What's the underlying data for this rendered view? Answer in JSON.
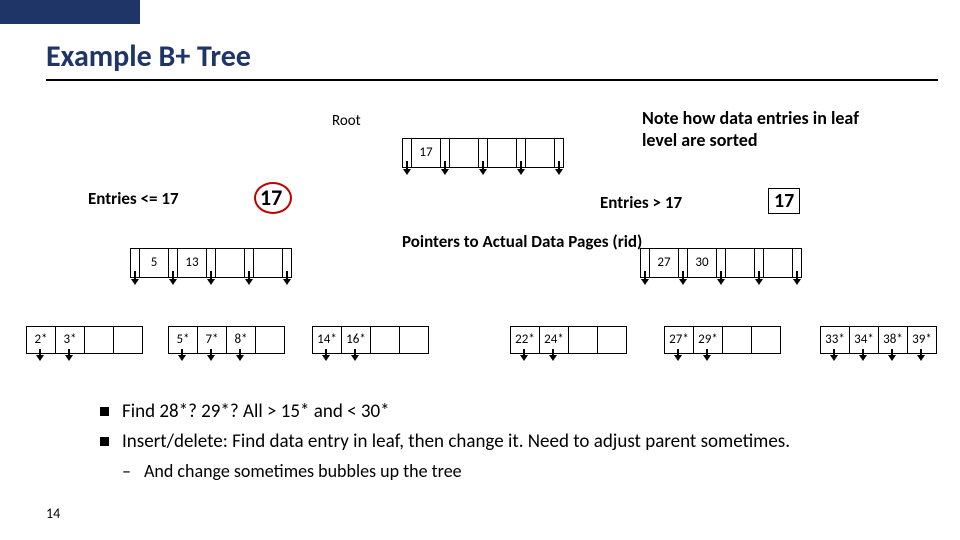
{
  "page_number": "14",
  "title": "Example B+ Tree",
  "root_label": "Root",
  "left_branch_label": "Entries <=  17",
  "right_branch_label": "Entries >  17",
  "circle_value_left": "17",
  "circle_value_right": "17",
  "note_box": "Note how data entries in leaf level are sorted",
  "mid_annotation": "Pointers to Actual Data Pages  (rid)",
  "root_node": {
    "keys": [
      "17",
      "",
      "",
      ""
    ]
  },
  "internal_left": {
    "keys": [
      "5",
      "13",
      "",
      ""
    ]
  },
  "internal_right": {
    "keys": [
      "27",
      "30",
      "",
      ""
    ]
  },
  "leaves": [
    [
      "2*",
      "3*",
      "",
      ""
    ],
    [
      "5*",
      "7*",
      "8*",
      ""
    ],
    [
      "14*",
      "16*",
      "",
      ""
    ],
    [
      "22*",
      "24*",
      "",
      ""
    ],
    [
      "27*",
      "29*",
      "",
      ""
    ],
    [
      "33*",
      "34*",
      "38*",
      "39*"
    ]
  ],
  "bullets": [
    "Find 28*? 29*? All > 15* and < 30*",
    "Insert/delete:  Find data entry in leaf, then change it. Need to adjust parent sometimes."
  ],
  "sub_bullet": "And change sometimes bubbles up the tree",
  "chart_data": {
    "type": "table",
    "structure": "B+ tree",
    "root_keys": [
      17
    ],
    "internal_nodes": [
      {
        "side": "left",
        "keys": [
          5,
          13
        ]
      },
      {
        "side": "right",
        "keys": [
          27,
          30
        ]
      }
    ],
    "leaf_nodes": [
      [
        2,
        3
      ],
      [
        5,
        7,
        8
      ],
      [
        14,
        16
      ],
      [
        22,
        24
      ],
      [
        27,
        29
      ],
      [
        33,
        34,
        38,
        39
      ]
    ],
    "order": 5,
    "annotation_left": "Entries <= 17",
    "annotation_right": "Entries > 17"
  }
}
